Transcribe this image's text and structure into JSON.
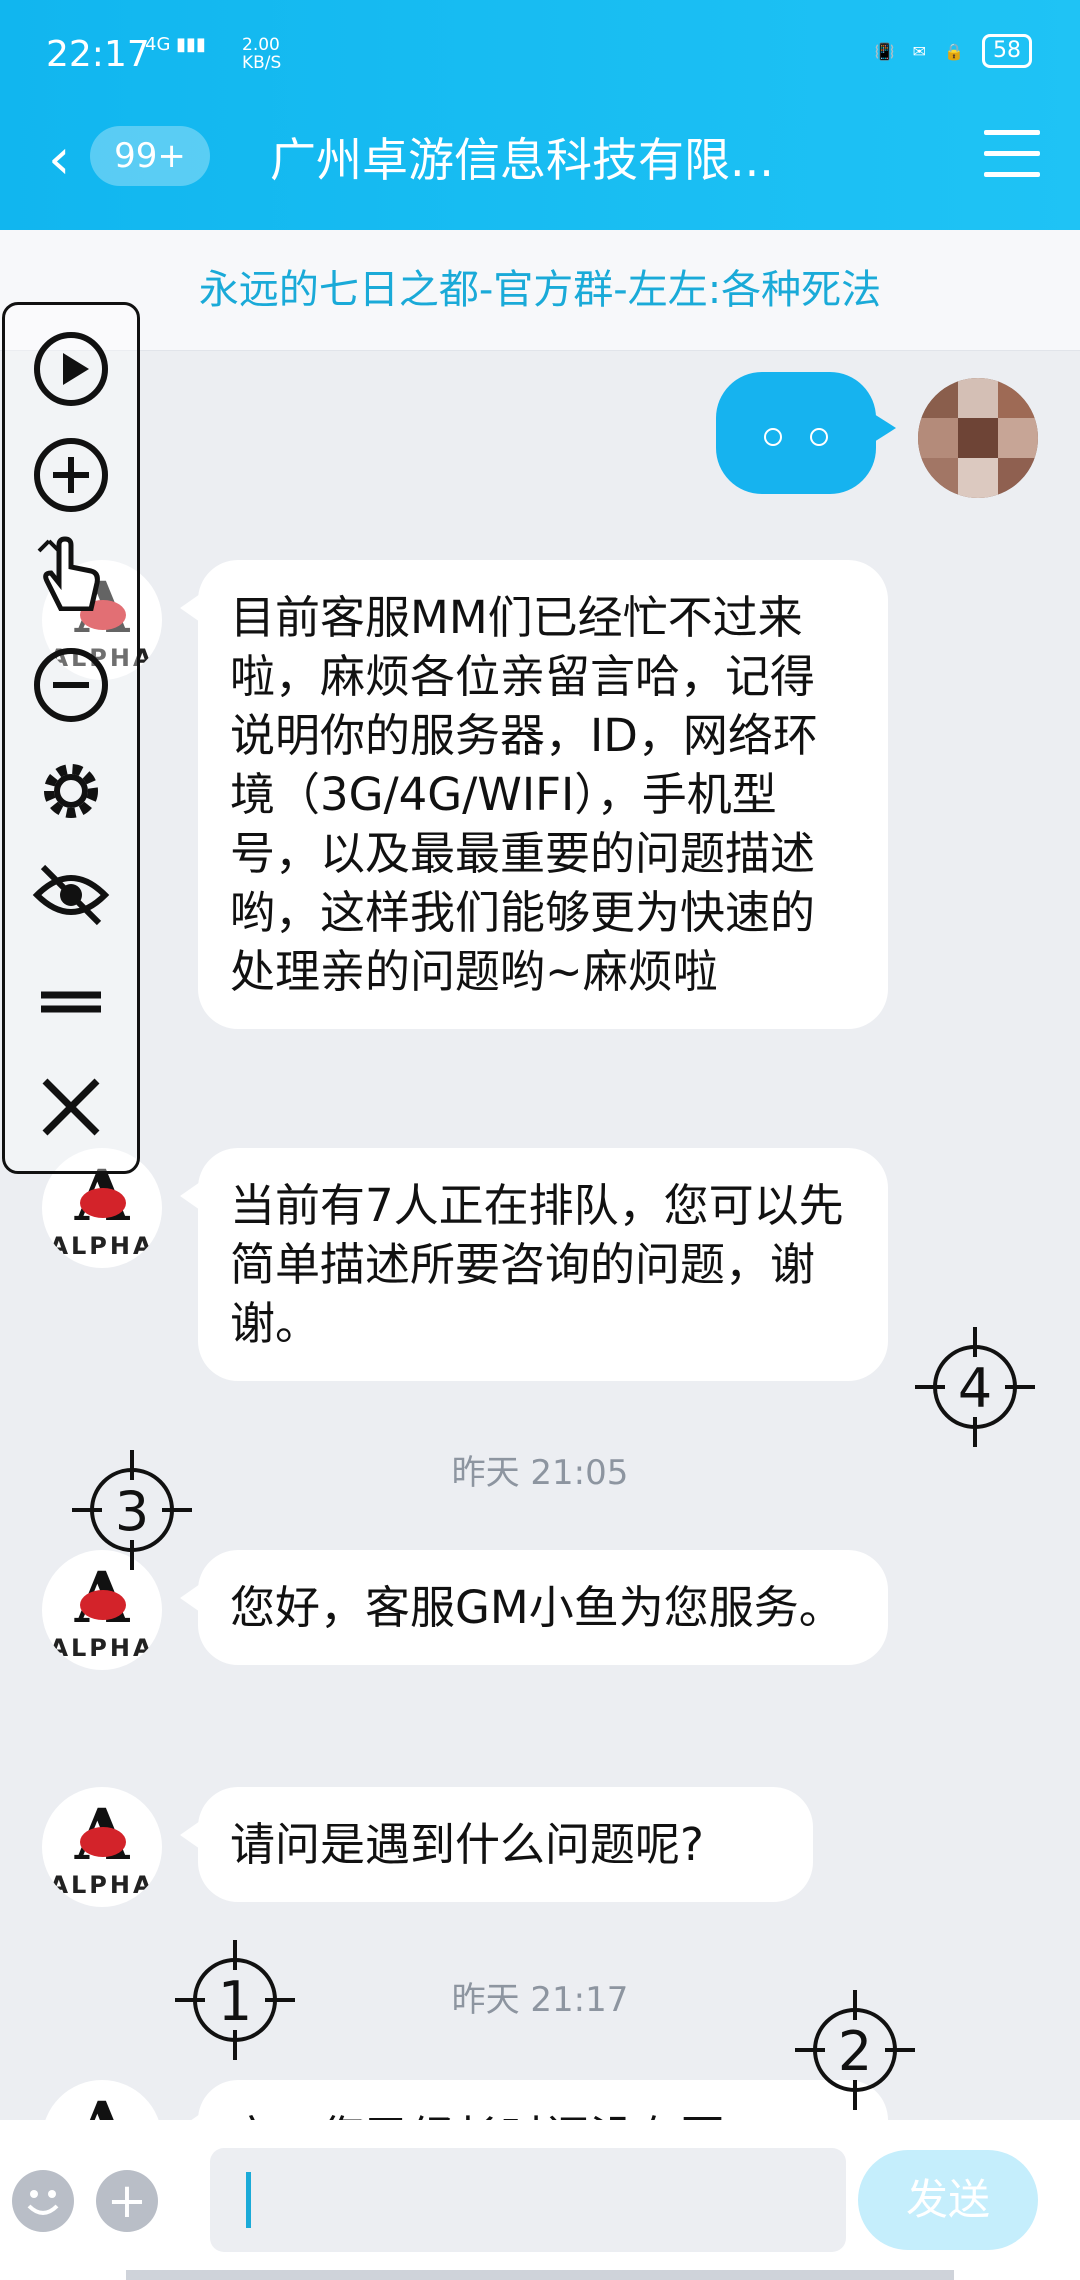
{
  "status_bar": {
    "time": "22:17",
    "signal_label": "4G",
    "net_speed_line1": "2.00",
    "net_speed_line2": "KB/S",
    "battery": "58",
    "icons": [
      "vibrate-icon",
      "message-block-icon",
      "lock-icon"
    ]
  },
  "nav": {
    "back_icon": "chevron-left-icon",
    "badge": "99+",
    "title": "广州卓游信息科技有限...",
    "menu_icon": "menu-icon"
  },
  "group_name": "永远的七日之都-官方群-左左:各种死法",
  "messages": [
    {
      "sender": "me",
      "text": "。。"
    },
    {
      "sender": "agent",
      "text": "目前客服MM们已经忙不过来啦，麻烦各位亲留言哈，记得说明你的服务器，ID，网络环境（3G/4G/WIFI），手机型号，以及最最重要的问题描述哟，这样我们能够更为快速的处理亲的问题哟~麻烦啦"
    },
    {
      "sender": "agent",
      "text": "当前有7人正在排队，您可以先简单描述所要咨询的问题，谢谢。"
    },
    {
      "sender": "agent",
      "text": "您好，客服GM小鱼为您服务。"
    },
    {
      "sender": "agent",
      "text": "请问是遇到什么问题呢?"
    },
    {
      "sender": "agent",
      "text": "亲，您已经长时间没有回..."
    }
  ],
  "timestamps": [
    "昨天 21:05",
    "昨天 21:17"
  ],
  "avatar_text": "ALPHA",
  "avatar_letter": "A",
  "toolbar": [
    "play-icon",
    "zoom-in-icon",
    "tap-icon",
    "zoom-out-icon",
    "gear-icon",
    "eye-off-icon",
    "drag-handle-icon",
    "close-icon"
  ],
  "targets": [
    "1",
    "2",
    "3",
    "4"
  ],
  "input": {
    "placeholder": ""
  },
  "send_label": "发送",
  "colors": {
    "header": "#11b6ef",
    "my_bubble": "#16b3ef",
    "send_disabled": "#c5eefc",
    "bg": "#eceef2"
  }
}
